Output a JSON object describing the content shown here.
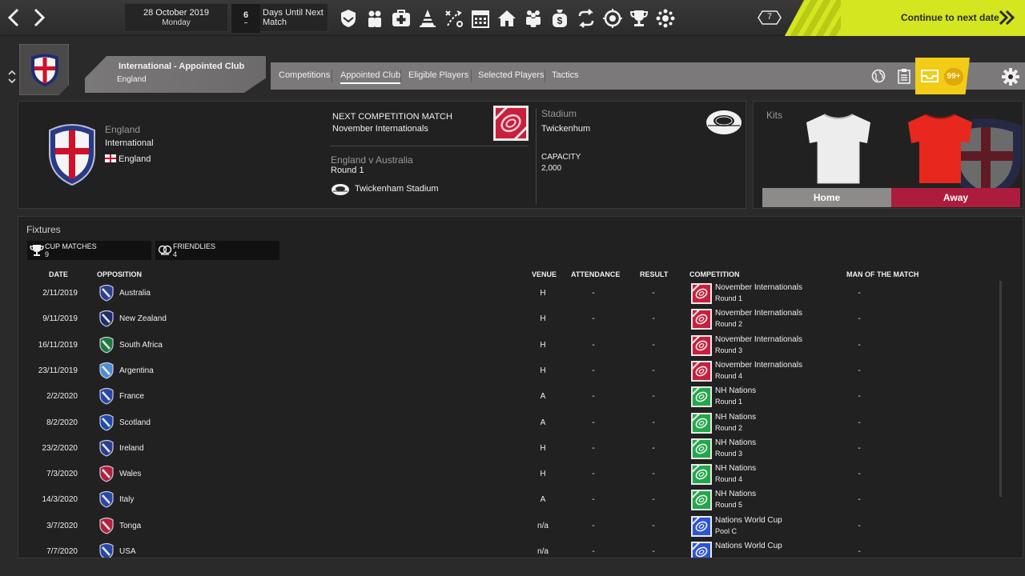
{
  "topbar": {
    "date": "28 October 2019",
    "weekday": "Monday",
    "days_until": "6",
    "days_label": "Days Until Next Match",
    "badge_count": "7",
    "continue_label": "Continue to next date",
    "accent": "#d3e61f"
  },
  "club": {
    "title": "International - Appointed Club",
    "subtitle": "England",
    "name": "England",
    "type": "International",
    "nation": "England"
  },
  "tabs": [
    "Competitions",
    "Appointed Club",
    "Eligible Players",
    "Selected Players",
    "Tactics"
  ],
  "active_tab": "Appointed Club",
  "inbox_count": "99+",
  "next_match": {
    "label": "NEXT COMPETITION MATCH",
    "competition": "November Internationals",
    "fixture": "England v Australia",
    "round": "Round 1",
    "venue": "Twickenham Stadium"
  },
  "stadium": {
    "label": "Stadium",
    "name": "Twickenhum",
    "capacity_label": "CAPACITY",
    "capacity": "2,000"
  },
  "kits": {
    "title": "Kits",
    "home": "Home",
    "away": "Away"
  },
  "fixtures": {
    "title": "Fixtures",
    "cup_label": "CUP MATCHES",
    "cup_count": "9",
    "friendlies_label": "FRIENDLIES",
    "friendlies_count": "4",
    "headers": {
      "date": "DATE",
      "opposition": "OPPOSITION",
      "venue": "VENUE",
      "attendance": "ATTENDANCE",
      "result": "RESULT",
      "competition": "COMPETITION",
      "motm": "MAN OF THE MATCH"
    },
    "rows": [
      {
        "date": "2/11/2019",
        "opp": "Australia",
        "venue": "H",
        "att": "-",
        "res": "-",
        "comp": "November Internationals",
        "round": "Round 1",
        "motm": "-",
        "comp_color": "#c8203c",
        "crest": "#2a3f8f"
      },
      {
        "date": "9/11/2019",
        "opp": "New Zealand",
        "venue": "H",
        "att": "-",
        "res": "-",
        "comp": "November Internationals",
        "round": "Round 2",
        "motm": "-",
        "comp_color": "#c8203c",
        "crest": "#1d2e6a"
      },
      {
        "date": "16/11/2019",
        "opp": "South Africa",
        "venue": "H",
        "att": "-",
        "res": "-",
        "comp": "November Internationals",
        "round": "Round 3",
        "motm": "-",
        "comp_color": "#c8203c",
        "crest": "#1f7a3a"
      },
      {
        "date": "23/11/2019",
        "opp": "Argentina",
        "venue": "H",
        "att": "-",
        "res": "-",
        "comp": "November Internationals",
        "round": "Round 4",
        "motm": "-",
        "comp_color": "#c8203c",
        "crest": "#4a8ed6"
      },
      {
        "date": "2/2/2020",
        "opp": "France",
        "venue": "A",
        "att": "-",
        "res": "-",
        "comp": "NH Nations",
        "round": "Round 1",
        "motm": "-",
        "comp_color": "#22a84a",
        "crest": "#2a46a8"
      },
      {
        "date": "8/2/2020",
        "opp": "Scotland",
        "venue": "A",
        "att": "-",
        "res": "-",
        "comp": "NH Nations",
        "round": "Round 2",
        "motm": "-",
        "comp_color": "#22a84a",
        "crest": "#1f4aa8"
      },
      {
        "date": "23/2/2020",
        "opp": "Ireland",
        "venue": "H",
        "att": "-",
        "res": "-",
        "comp": "NH Nations",
        "round": "Round 3",
        "motm": "-",
        "comp_color": "#22a84a",
        "crest": "#2a3f8f"
      },
      {
        "date": "7/3/2020",
        "opp": "Wales",
        "venue": "H",
        "att": "-",
        "res": "-",
        "comp": "NH Nations",
        "round": "Round 4",
        "motm": "-",
        "comp_color": "#22a84a",
        "crest": "#b3203a"
      },
      {
        "date": "14/3/2020",
        "opp": "Italy",
        "venue": "A",
        "att": "-",
        "res": "-",
        "comp": "NH Nations",
        "round": "Round 5",
        "motm": "-",
        "comp_color": "#22a84a",
        "crest": "#2a46a8"
      },
      {
        "date": "3/7/2020",
        "opp": "Tonga",
        "venue": "n/a",
        "att": "-",
        "res": "-",
        "comp": "Nations World Cup",
        "round": "Pool C",
        "motm": "-",
        "comp_color": "#2d54d6",
        "crest": "#b3203a"
      },
      {
        "date": "7/7/2020",
        "opp": "USA",
        "venue": "n/a",
        "att": "-",
        "res": "-",
        "comp": "Nations World Cup",
        "round": "",
        "motm": "-",
        "comp_color": "#2d54d6",
        "crest": "#2a46a8"
      }
    ]
  }
}
